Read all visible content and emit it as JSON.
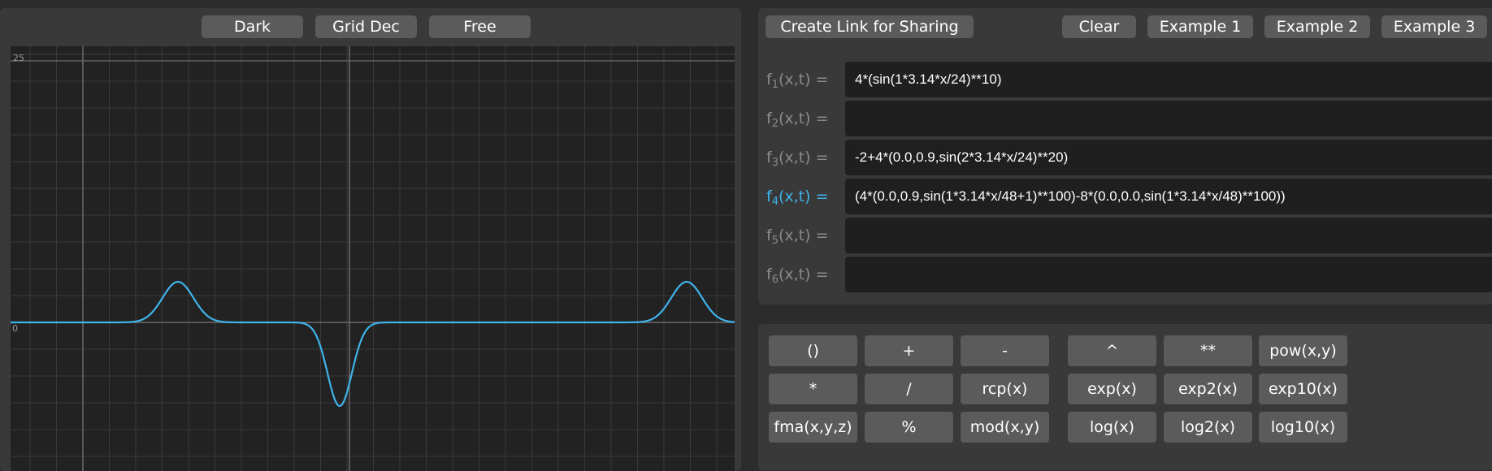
{
  "top_buttons": {
    "theme": "Dark",
    "grid": "Grid Dec",
    "mode": "Free"
  },
  "right_buttons": {
    "share": "Create Link for Sharing",
    "clear": "Clear",
    "example1": "Example 1",
    "example2": "Example 2",
    "example3": "Example 3"
  },
  "plot": {
    "y_top_label": "25",
    "y_zero_label": "0",
    "curve_color": "#3fb3ea",
    "grid_color": "#3a3a3a",
    "axis_color": "#6a6a6a"
  },
  "functions": [
    {
      "name": "f",
      "sub": "1",
      "args": "(x,t) =",
      "expr": "4*(sin(1*3.14*x/24)**10)",
      "active": false
    },
    {
      "name": "f",
      "sub": "2",
      "args": "(x,t) =",
      "expr": "",
      "active": false
    },
    {
      "name": "f",
      "sub": "3",
      "args": "(x,t) =",
      "expr": "-2+4*(0.0,0.9,sin(2*3.14*x/24)**20)",
      "active": false
    },
    {
      "name": "f",
      "sub": "4",
      "args": "(x,t) =",
      "expr": "(4*(0.0,0.9,sin(1*3.14*x/48+1)**100)-8*(0.0,0.0,sin(1*3.14*x/48)**100))",
      "active": true
    },
    {
      "name": "f",
      "sub": "5",
      "args": "(x,t) =",
      "expr": "",
      "active": false
    },
    {
      "name": "f",
      "sub": "6",
      "args": "(x,t) =",
      "expr": "",
      "active": false
    }
  ],
  "keypad": {
    "paren": "()",
    "plus": "+",
    "minus": "-",
    "caret": "^",
    "power": "**",
    "pow": "pow(x,y)",
    "mul": "*",
    "div": "/",
    "rcp": "rcp(x)",
    "exp": "exp(x)",
    "exp2": "exp2(x)",
    "exp10": "exp10(x)",
    "fma": "fma(x,y,z)",
    "percent": "%",
    "mod": "mod(x,y)",
    "log": "log(x)",
    "log2": "log2(x)",
    "log10": "log10(x)"
  }
}
